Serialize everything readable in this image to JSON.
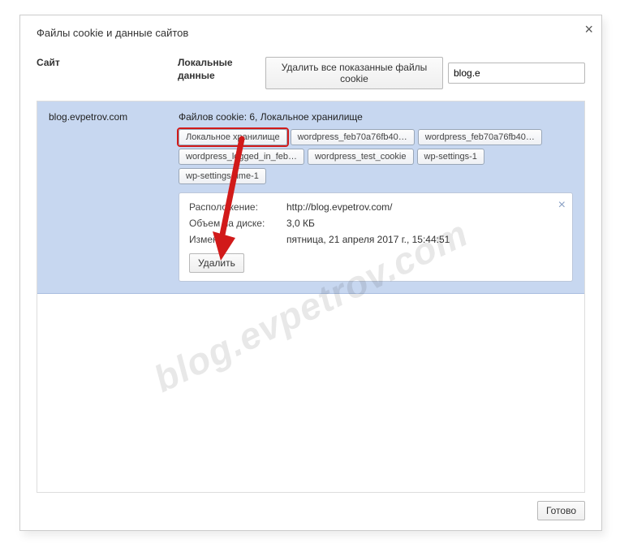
{
  "dialog": {
    "title": "Файлы cookie и данные сайтов",
    "close_icon": "×"
  },
  "columns": {
    "site_label": "Сайт",
    "local_data_label": "Локальные данные"
  },
  "actions": {
    "clear_all_label": "Удалить все показанные файлы cookie",
    "search_value": "blog.e"
  },
  "site": {
    "name": "blog.evpetrov.com",
    "summary": "Файлов cookie: 6, Локальное хранилище",
    "chips_row1": [
      "Локальное хранилище",
      "wordpress_feb70a76fb40…",
      "wordpress_feb70a76fb40…"
    ],
    "chips_row2": [
      "wordpress_logged_in_feb…",
      "wordpress_test_cookie",
      "wp-settings-1",
      "wp-settings-time-1"
    ]
  },
  "detail": {
    "location_label": "Расположение:",
    "location_value": "http://blog.evpetrov.com/",
    "size_label": "Объем на диске:",
    "size_value": "3,0 КБ",
    "modified_label": "Изменен:",
    "modified_value": "пятница, 21 апреля 2017 г., 15:44:51",
    "delete_label": "Удалить",
    "close_icon": "×"
  },
  "footer": {
    "done_label": "Готово"
  },
  "watermark": "blog.evpetrov.com"
}
